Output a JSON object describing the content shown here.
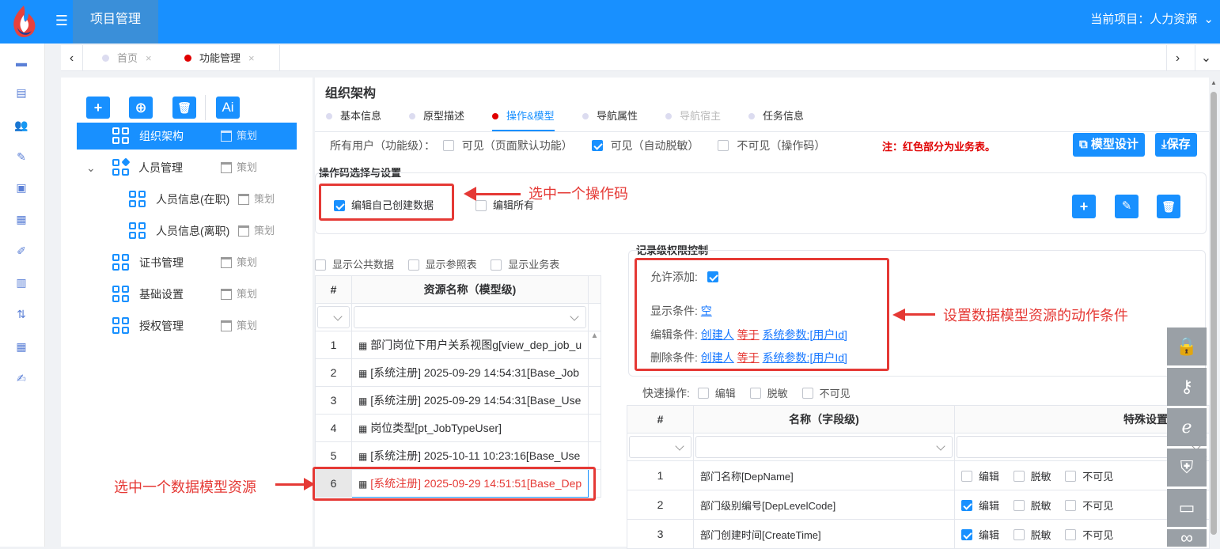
{
  "header": {
    "app_title": "项目管理",
    "project_label": "当前项目：人力资源",
    "chevron": "⌄",
    "colors": {
      "primary": "#1890ff",
      "accent_red": "#e53935"
    }
  },
  "left_nav_icons": [
    "monitor-icon",
    "list-icon",
    "users-icon",
    "design-icon",
    "document-icon",
    "table-icon",
    "edit-icon",
    "clipboard-icon",
    "flow-icon",
    "grid-icon",
    "report-icon"
  ],
  "tabs": [
    {
      "label": "首页",
      "close": "×",
      "dot_color": "#dcdcf0"
    },
    {
      "label": "功能管理",
      "close": "×",
      "dot_color": "#e00000"
    }
  ],
  "tab_nav": {
    "left": "‹",
    "right": "›",
    "menu": "⌄"
  },
  "toolbar": {
    "add": "+",
    "add_circle": "⊕",
    "delete": "🗑",
    "ai": "Ai"
  },
  "tree": [
    {
      "label": "组织架构",
      "tag": "策划",
      "selected": true
    },
    {
      "label": "人员管理",
      "tag": "策划",
      "expand": "⌄"
    },
    {
      "label": "人员信息(在职)",
      "tag": "策划"
    },
    {
      "label": "人员信息(离职)",
      "tag": "策划"
    },
    {
      "label": "证书管理",
      "tag": "策划"
    },
    {
      "label": "基础设置",
      "tag": "策划"
    },
    {
      "label": "授权管理",
      "tag": "策划"
    }
  ],
  "main": {
    "title": "组织架构",
    "subtabs": [
      "基本信息",
      "原型描述",
      "操作&模型",
      "导航属性",
      "导航宿主",
      "任务信息"
    ],
    "users_label": "所有用户（功能级）：",
    "vis_options": [
      "可见（页面默认功能）",
      "可见（自动脱敏）",
      "不可见（操作码）"
    ],
    "note": "注：红色部分为业务表。",
    "btn_model_design": "模型设计",
    "btn_save": "保存",
    "opcode_section": "操作码选择与设置",
    "opcode_items": [
      "编辑自己创建数据",
      "编辑所有"
    ],
    "annot_opcode": "选中一个操作码",
    "record_section": "记录级权限控制",
    "allow_add": "允许添加:",
    "show_cond_label": "显示条件:",
    "show_cond_value": "空",
    "edit_cond_label": "编辑条件:",
    "delete_cond_label": "删除条件:",
    "cond_field": "创建人",
    "cond_op": "等于",
    "cond_param": "系统参数:[用户Id]",
    "annot_record": "设置数据模型资源的动作条件",
    "show_filters": [
      "显示公共数据",
      "显示参照表",
      "显示业务表"
    ],
    "res_table": {
      "headers": [
        "#",
        "资源名称（模型级)"
      ],
      "rows": [
        {
          "no": "1",
          "name": "部门岗位下用户关系视图g[view_dep_job_u"
        },
        {
          "no": "2",
          "name": "[系统注册] 2025-09-29 14:54:31[Base_Job"
        },
        {
          "no": "3",
          "name": "[系统注册] 2025-09-29 14:54:31[Base_Use"
        },
        {
          "no": "4",
          "name": "岗位类型[pt_JobTypeUser]"
        },
        {
          "no": "5",
          "name": "[系统注册] 2025-10-11 10:23:16[Base_Use"
        },
        {
          "no": "6",
          "name": "[系统注册] 2025-09-29 14:51:51[Base_Dep"
        }
      ]
    },
    "annot_resource": "选中一个数据模型资源",
    "quick_ops_label": "快速操作:",
    "quick_ops": [
      "编辑",
      "脱敏",
      "不可见"
    ],
    "field_table": {
      "headers": [
        "#",
        "名称（字段级)",
        "特殊设置"
      ],
      "rows": [
        {
          "no": "1",
          "name": "部门名称[DepName]",
          "edit": false
        },
        {
          "no": "2",
          "name": "部门级别编号[DepLevelCode]",
          "edit": true
        },
        {
          "no": "3",
          "name": "部门创建时间[CreateTime]",
          "edit": true
        }
      ],
      "opts": [
        "编辑",
        "脱敏",
        "不可见"
      ]
    }
  }
}
